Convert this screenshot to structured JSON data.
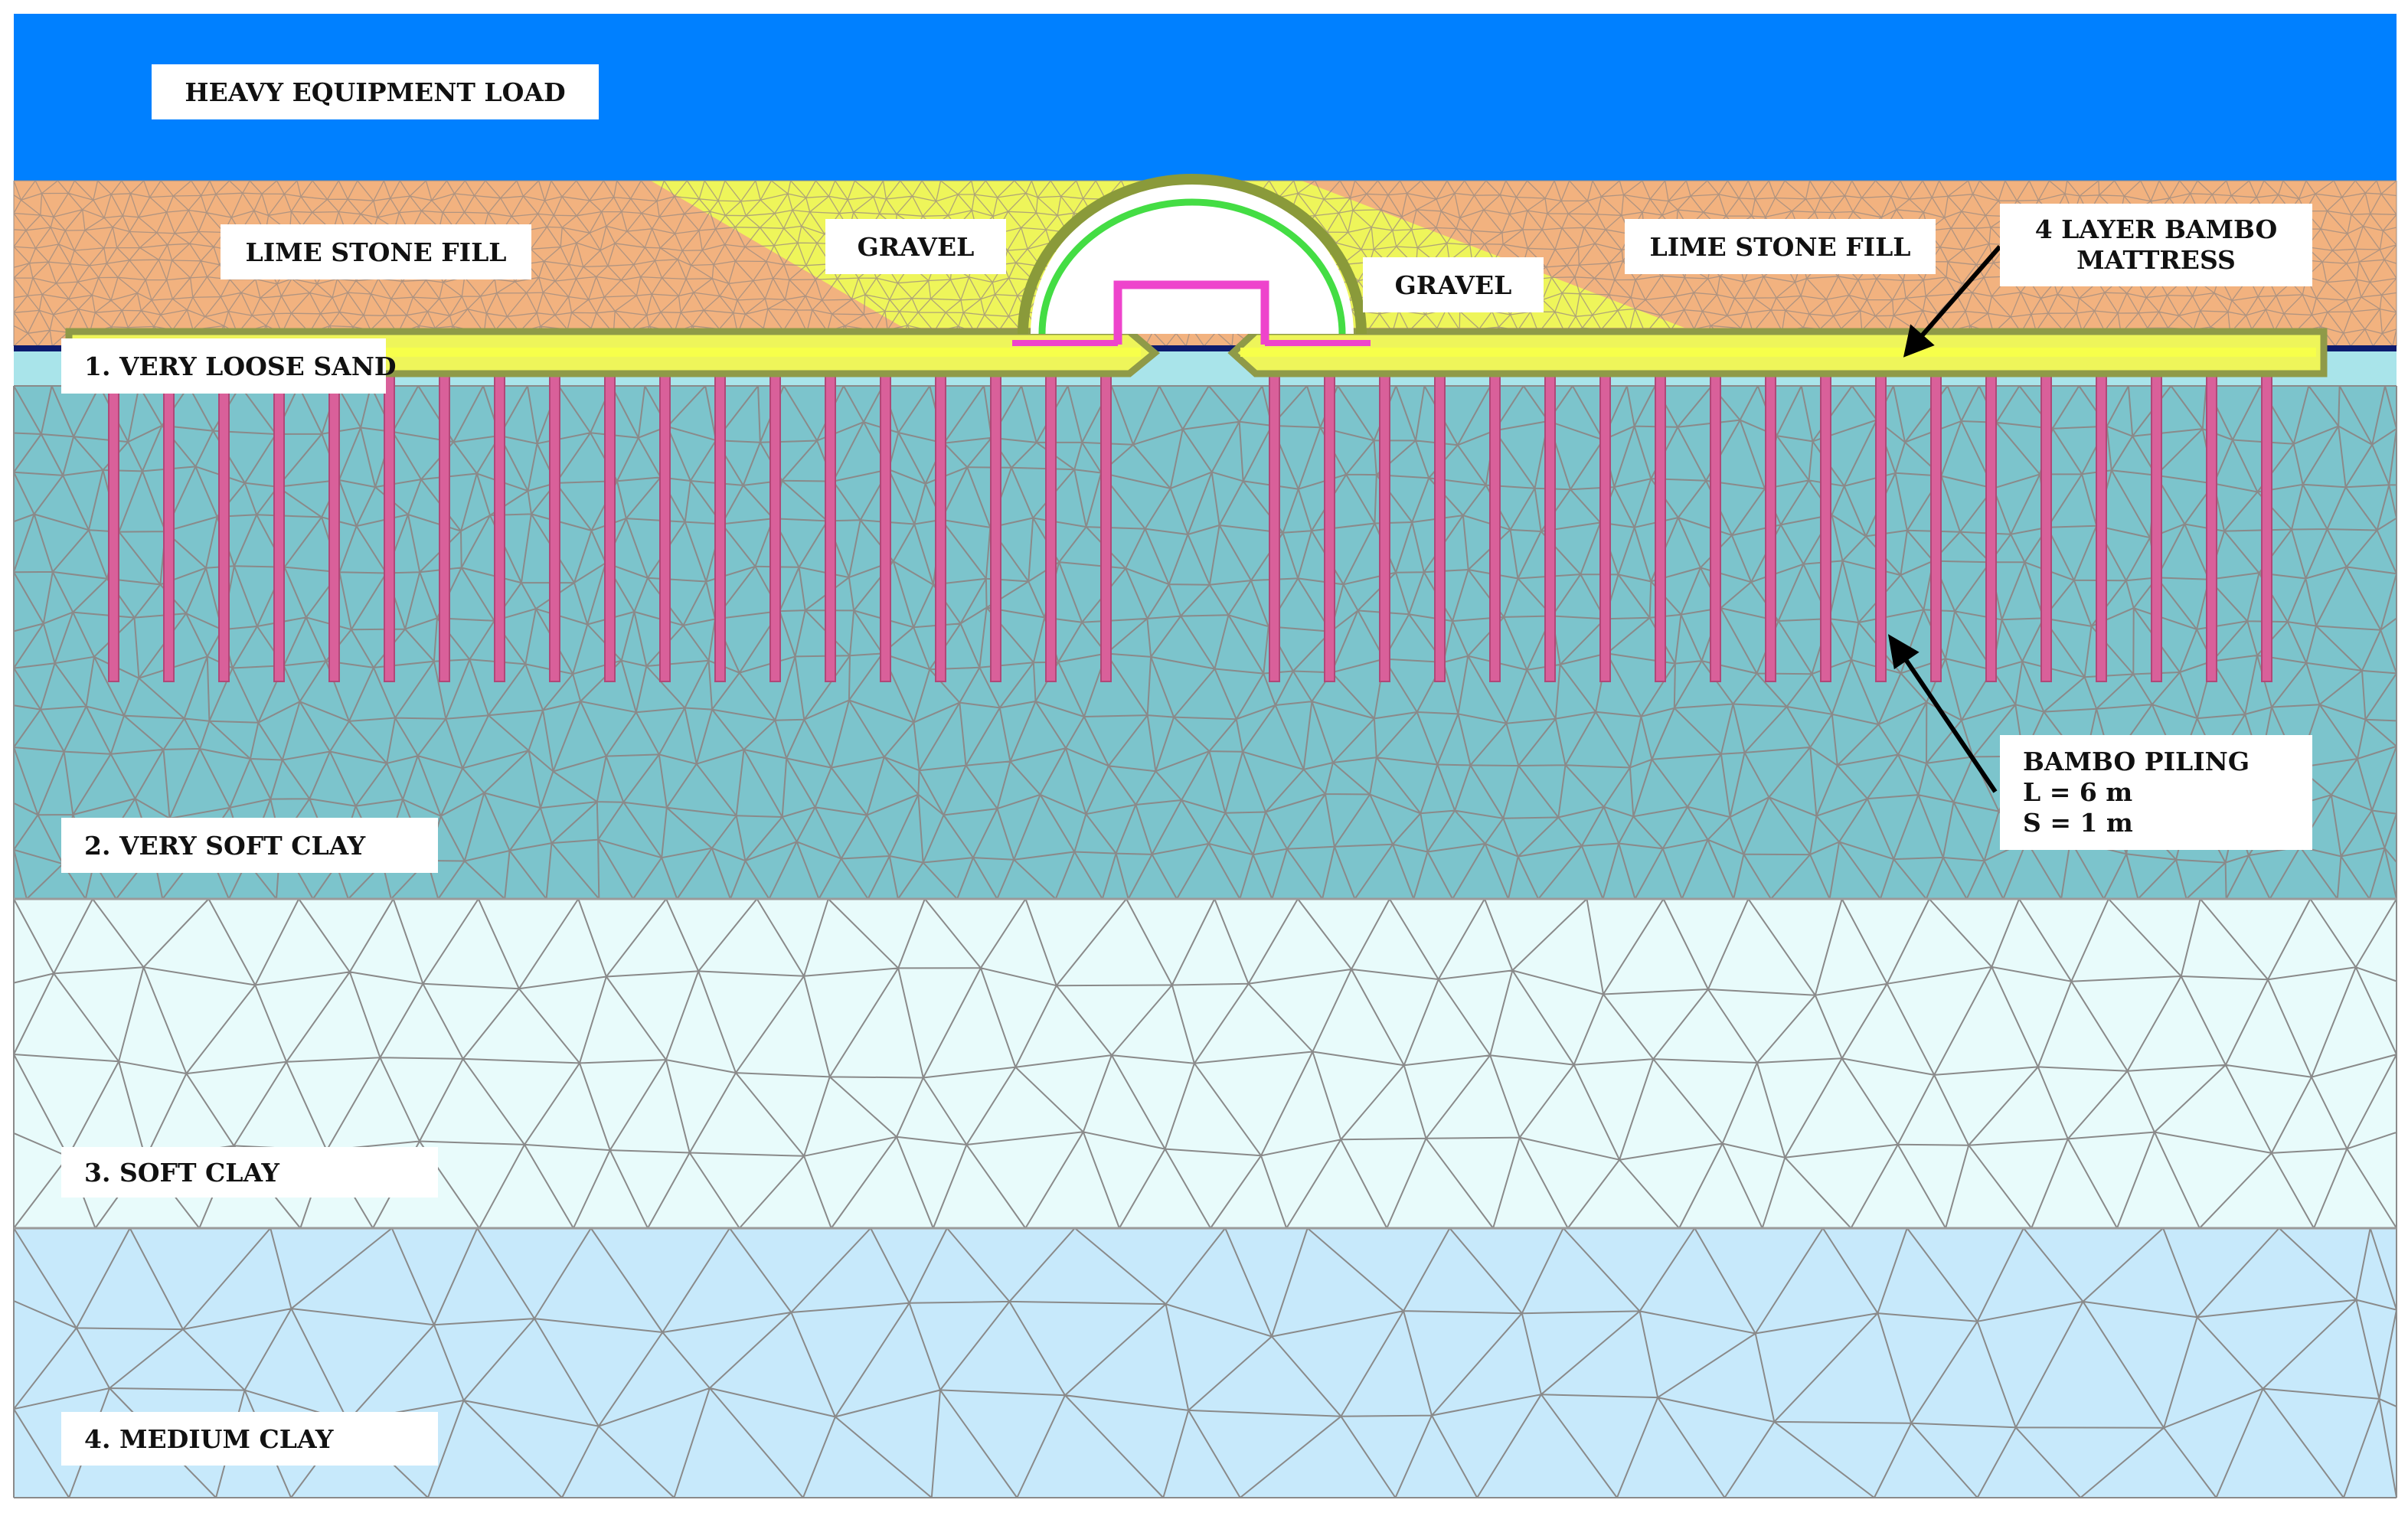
{
  "labels": {
    "heavy_load": "HEAVY EQUIPMENT LOAD",
    "limestone_left": "LIME STONE FILL",
    "gravel_left": "GRAVEL",
    "gravel_right": "GRAVEL",
    "limestone_right": "LIME STONE FILL",
    "mattress_line1": "4 LAYER BAMBO",
    "mattress_line2": "MATTRESS",
    "layer1": "1. VERY LOOSE SAND",
    "layer2": "2. VERY SOFT CLAY",
    "layer3": "3. SOFT CLAY",
    "layer4": "4. MEDIUM CLAY",
    "piling_line1": "BAMBO PILING",
    "piling_line2": "L = 6 m",
    "piling_line3": "S = 1 m"
  },
  "colors": {
    "load": "#0080ff",
    "limestone_fill": "#f2b27f",
    "gravel": "#eef55a",
    "very_loose_sand": "#a9e4ea",
    "very_soft_clay": "#7cc4cc",
    "soft_clay": "#e8fbfb",
    "medium_clay": "#c7e9fb",
    "bamboo_pile": "#d9609a",
    "mattress": "#9aa05a",
    "culvert_outer": "#8a9a3a",
    "culvert_inner": "#44dd44",
    "culvert_box": "#ee44cc",
    "mesh": "#8a8a8a"
  }
}
